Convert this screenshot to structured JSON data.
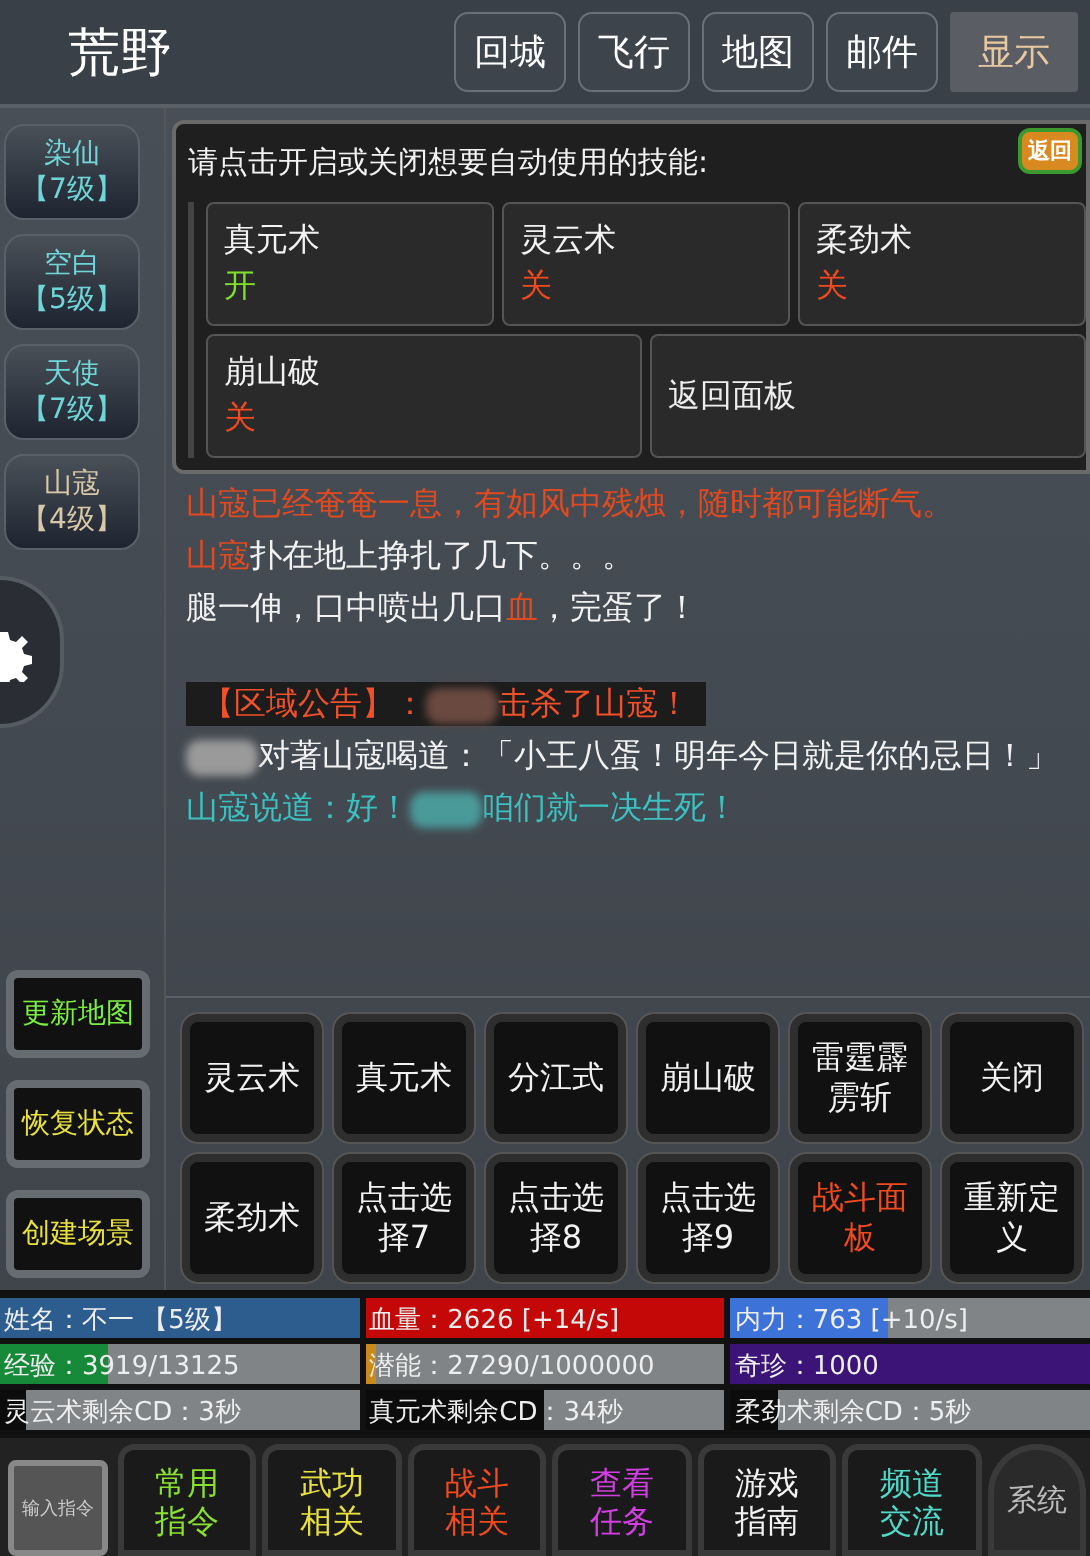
{
  "header": {
    "title": "荒野",
    "buttons": [
      {
        "label": "回城",
        "selected": false
      },
      {
        "label": "飞行",
        "selected": false
      },
      {
        "label": "地图",
        "selected": false
      },
      {
        "label": "邮件",
        "selected": false
      },
      {
        "label": "显示",
        "selected": true
      }
    ]
  },
  "npcs": [
    {
      "name": "染仙",
      "level": "【7级】",
      "color": "#6fd6d8"
    },
    {
      "name": "空白",
      "level": "【5级】",
      "color": "#6fd6d8"
    },
    {
      "name": "天使",
      "level": "【7级】",
      "color": "#6fd6d8"
    },
    {
      "name": "山寇",
      "level": "【4级】",
      "color": "#d8c8a8"
    }
  ],
  "side_actions": [
    {
      "label": "更新地图",
      "highlighted": true
    },
    {
      "label": "恢复状态",
      "highlighted": false
    },
    {
      "label": "创建场景",
      "highlighted": false
    }
  ],
  "auto_panel": {
    "prompt": "请点击开启或关闭想要自动使用的技能:",
    "back_badge": "返回",
    "skills": [
      {
        "name": "真元术",
        "state": "开",
        "on": true
      },
      {
        "name": "灵云术",
        "state": "关",
        "on": false
      },
      {
        "name": "柔劲术",
        "state": "关",
        "on": false
      },
      {
        "name": "崩山破",
        "state": "关",
        "on": false
      }
    ],
    "return_button": "返回面板"
  },
  "log": [
    {
      "segments": [
        {
          "kind": "text",
          "text": "山寇已经奄奄一息，有如风中残烛，随时都可能断气。",
          "color": "#e04a20"
        }
      ]
    },
    {
      "segments": [
        {
          "kind": "text",
          "text": "山寇",
          "color": "#e04a20"
        },
        {
          "kind": "text",
          "text": "扑在地上挣扎了几下。。。",
          "color": "#f2f2f2"
        }
      ]
    },
    {
      "segments": [
        {
          "kind": "text",
          "text": "腿一伸，口中喷出几口",
          "color": "#f2f2f2"
        },
        {
          "kind": "text",
          "text": "血",
          "color": "#e04a20"
        },
        {
          "kind": "text",
          "text": "，完蛋了！",
          "color": "#f2f2f2"
        }
      ]
    },
    {
      "banner": true,
      "segments": [
        {
          "kind": "text",
          "text": "【区域公告】："
        },
        {
          "kind": "blur",
          "color": "#6a4a40"
        },
        {
          "kind": "text",
          "text": "击杀了山寇！"
        }
      ]
    },
    {
      "segments": [
        {
          "kind": "blur",
          "color": "#9a9a9a"
        },
        {
          "kind": "text",
          "text": "对著山寇喝道：「小王八蛋！明年今日就是你的忌日！」",
          "color": "#f2f2f2"
        }
      ]
    },
    {
      "segments": [
        {
          "kind": "text",
          "text": "山寇说道：好！",
          "color": "#3cc0c0"
        },
        {
          "kind": "blur",
          "color": "#4a9a9a"
        },
        {
          "kind": "text",
          "text": "咱们就一决生死！",
          "color": "#3cc0c0"
        }
      ]
    }
  ],
  "skill_buttons": [
    {
      "label": "灵云术",
      "highlighted": false
    },
    {
      "label": "真元术",
      "highlighted": false
    },
    {
      "label": "分江式",
      "highlighted": false
    },
    {
      "label": "崩山破",
      "highlighted": false
    },
    {
      "label": "雷霆霹雳斩",
      "highlighted": false
    },
    {
      "label": "关闭",
      "highlighted": false
    },
    {
      "label": "柔劲术",
      "highlighted": false
    },
    {
      "label": "点击选择7",
      "highlighted": false
    },
    {
      "label": "点击选择8",
      "highlighted": false
    },
    {
      "label": "点击选择9",
      "highlighted": false
    },
    {
      "label": "战斗面板",
      "highlighted": true
    },
    {
      "label": "重新定义",
      "highlighted": false
    }
  ],
  "stats": [
    {
      "label": "姓名：不一 【5级】",
      "level": 1,
      "color": "#2d5d8e"
    },
    {
      "label": "血量：2626 [+14/s]",
      "level": 1,
      "color": "#c40808"
    },
    {
      "label": "内力：763 [+10/s]",
      "level": 0.44,
      "color": "#3d72d8"
    },
    {
      "label": "经验：3919/13125",
      "level": 0.3,
      "color": "#178a3a"
    },
    {
      "label": "潜能：27290/1000000",
      "level": 0.03,
      "color": "#c88a1a"
    },
    {
      "label": "奇珍：1000",
      "level": 1,
      "color": "#3c1478"
    },
    {
      "label": "灵云术剩余CD：3秒",
      "level": 0.07,
      "color": "#0c0c0c"
    },
    {
      "label": "真元术剩余CD：34秒",
      "level": 0.5,
      "color": "#0c0c0c"
    },
    {
      "label": "柔劲术剩余CD：5秒",
      "level": 0.13,
      "color": "#0c0c0c"
    }
  ],
  "bottom_bar": [
    {
      "kind": "command",
      "label": "输入指令"
    },
    {
      "kind": "menu",
      "label": "常用指令",
      "color": "#8ae030"
    },
    {
      "kind": "menu",
      "label": "武功相关",
      "color": "#e8e040"
    },
    {
      "kind": "menu",
      "label": "战斗相关",
      "color": "#f04a20"
    },
    {
      "kind": "menu",
      "label": "查看任务",
      "color": "#d040e0"
    },
    {
      "kind": "menu",
      "label": "游戏指南",
      "color": "#f2f2f2"
    },
    {
      "kind": "menu",
      "label": "频道交流",
      "color": "#50d8c8"
    },
    {
      "kind": "system",
      "label": "系统"
    }
  ]
}
